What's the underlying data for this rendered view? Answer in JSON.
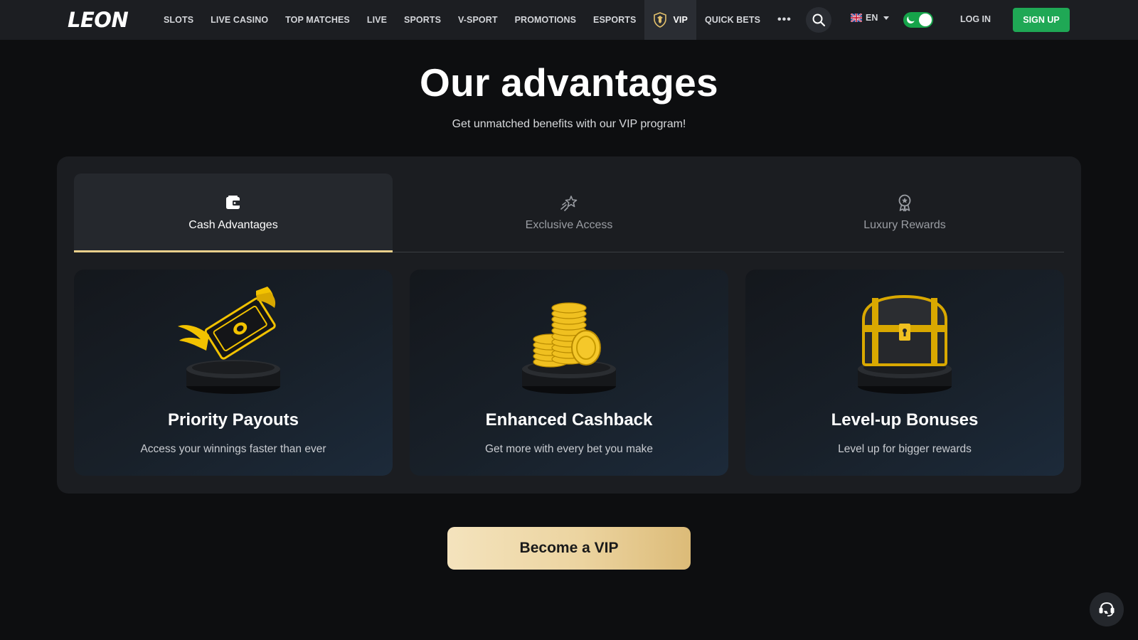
{
  "header": {
    "logo": "LEON",
    "nav": [
      "SLOTS",
      "LIVE CASINO",
      "TOP MATCHES",
      "LIVE",
      "SPORTS",
      "V-SPORT",
      "PROMOTIONS",
      "ESPORTS",
      "VIP",
      "QUICK BETS"
    ],
    "more_icon": "more-dots-icon",
    "search_icon": "search-icon",
    "language": "EN",
    "theme_toggle": "dark-mode-toggle",
    "login_label": "LOG IN",
    "signup_label": "SIGN UP"
  },
  "hero": {
    "title": "Our advantages",
    "subtitle": "Get unmatched benefits with our VIP program!"
  },
  "tabs": [
    {
      "label": "Cash Advantages",
      "icon": "wallet-icon",
      "active": true
    },
    {
      "label": "Exclusive Access",
      "icon": "shooting-star-icon",
      "active": false
    },
    {
      "label": "Luxury Rewards",
      "icon": "award-badge-icon",
      "active": false
    }
  ],
  "cards": [
    {
      "title": "Priority Payouts",
      "description": "Access your winnings faster than ever",
      "icon": "winged-money-icon"
    },
    {
      "title": "Enhanced Cashback",
      "description": "Get more with every bet you make",
      "icon": "coin-stack-icon"
    },
    {
      "title": "Level-up Bonuses",
      "description": "Level up for bigger rewards",
      "icon": "treasure-chest-icon"
    }
  ],
  "cta": {
    "label": "Become a VIP"
  },
  "support": {
    "icon": "chat-support-icon"
  },
  "colors": {
    "accent_gold": "#e9cf8c",
    "signup_green": "#1fa855",
    "header_bg": "#1c1e22",
    "page_bg": "#0d0e10"
  }
}
